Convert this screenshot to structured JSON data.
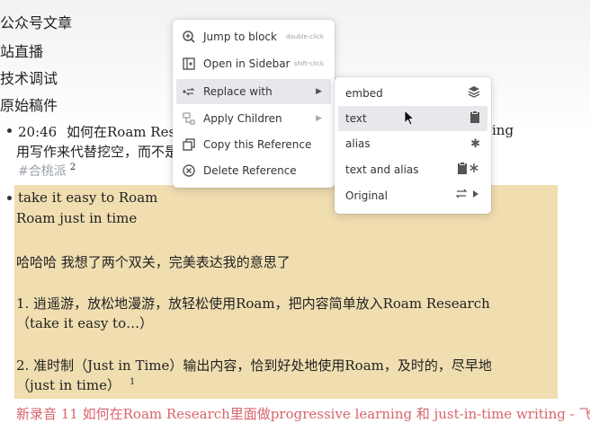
{
  "sidebar_items": [
    {
      "label": "公众号文章"
    },
    {
      "label": "站直播"
    },
    {
      "label": "技术调试"
    },
    {
      "label": "原始稿件"
    }
  ],
  "entry": {
    "time": "20:46",
    "title_part": "如何在Roam Resea",
    "title_tail": "ing",
    "line2": "用写作来代替挖空，而不是",
    "tag": "#合桃派",
    "tag_ref": "2"
  },
  "highlight_block": {
    "lines": [
      "take it easy to Roam",
      "Roam just in time",
      "哈哈哈 我想了两个双关，完美表达我的意思了",
      "1. 逍遥游，放松地漫游，放轻松使用Roam，把内容简单放入Roam Research",
      "（take it easy to…）",
      "2. 准时制（Just in Time）输出内容，恰到好处地使用Roam，及时的，尽早地",
      "（just in time）"
    ],
    "ref_count": "1"
  },
  "bottom_line": "新录音 11 如何在Roam Research里面做progressive learning 和 just-in-time writing - 飞",
  "context_menu": {
    "items": [
      {
        "label": "Jump to block",
        "hint": "double-click",
        "icon": "zoom-in-icon"
      },
      {
        "label": "Open in Sidebar",
        "hint": "shift-click",
        "icon": "sidebar-icon"
      },
      {
        "label": "Replace with",
        "icon": "replace-icon"
      },
      {
        "label": "Apply Children",
        "icon": "apply-children-icon"
      },
      {
        "label": "Copy this Reference",
        "icon": "copy-icon"
      },
      {
        "label": "Delete Reference",
        "icon": "delete-icon"
      }
    ]
  },
  "submenu": {
    "items": [
      {
        "label": "embed",
        "icon": "stack-icon"
      },
      {
        "label": "text",
        "icon": "clipboard-icon"
      },
      {
        "label": "alias",
        "icon": "asterisk-icon"
      },
      {
        "label": "text and alias",
        "icon": "clipboard-asterisk-icon"
      },
      {
        "label": "Original",
        "icon": "swap-arrow-icon"
      }
    ]
  }
}
